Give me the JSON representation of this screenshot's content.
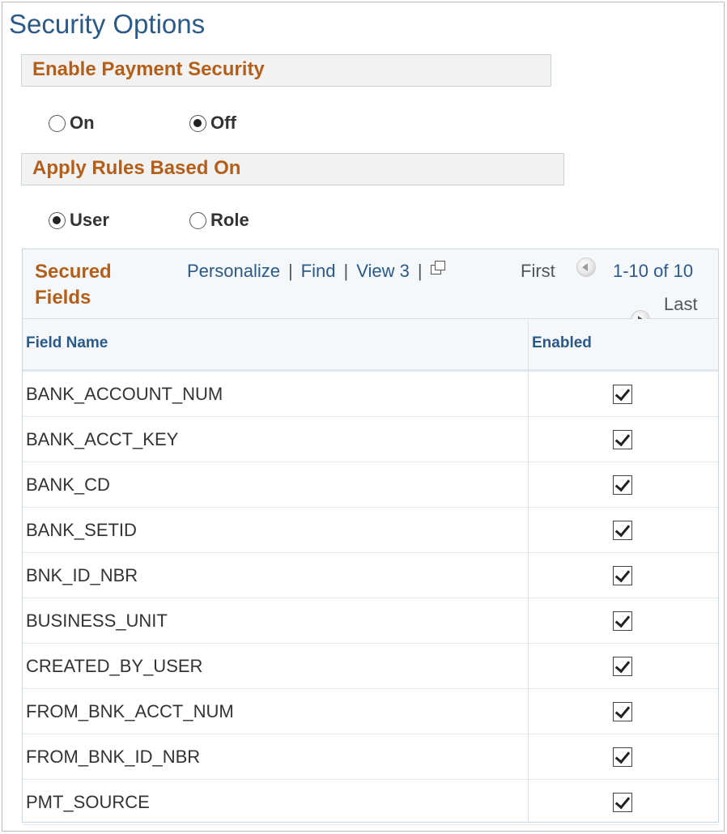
{
  "page": {
    "title": "Security Options"
  },
  "payment_security": {
    "label": "Enable Payment Security",
    "options": [
      {
        "label": "On",
        "checked": false
      },
      {
        "label": "Off",
        "checked": true
      }
    ]
  },
  "apply_rules": {
    "label": "Apply Rules Based On",
    "options": [
      {
        "label": "User",
        "checked": true
      },
      {
        "label": "Role",
        "checked": false
      }
    ]
  },
  "grid": {
    "title": "Secured Fields",
    "links": {
      "personalize": "Personalize",
      "find": "Find",
      "view": "View 3",
      "separator": "|"
    },
    "pager": {
      "first": "First",
      "count": "1-10 of 10",
      "last": "Last"
    },
    "columns": {
      "field_name": "Field Name",
      "enabled": "Enabled"
    },
    "rows": [
      {
        "field": "BANK_ACCOUNT_NUM",
        "enabled": true
      },
      {
        "field": "BANK_ACCT_KEY",
        "enabled": true
      },
      {
        "field": "BANK_CD",
        "enabled": true
      },
      {
        "field": "BANK_SETID",
        "enabled": true
      },
      {
        "field": "BNK_ID_NBR",
        "enabled": true
      },
      {
        "field": "BUSINESS_UNIT",
        "enabled": true
      },
      {
        "field": "CREATED_BY_USER",
        "enabled": true
      },
      {
        "field": "FROM_BNK_ACCT_NUM",
        "enabled": true
      },
      {
        "field": "FROM_BNK_ID_NBR",
        "enabled": true
      },
      {
        "field": "PMT_SOURCE",
        "enabled": true
      }
    ]
  },
  "colors": {
    "title": "#2b5a88",
    "section": "#b35f19",
    "link": "#2b5a88"
  },
  "icons": {
    "new_window": "new-window-icon",
    "prev": "previous-arrow-icon",
    "next": "next-arrow-icon"
  }
}
